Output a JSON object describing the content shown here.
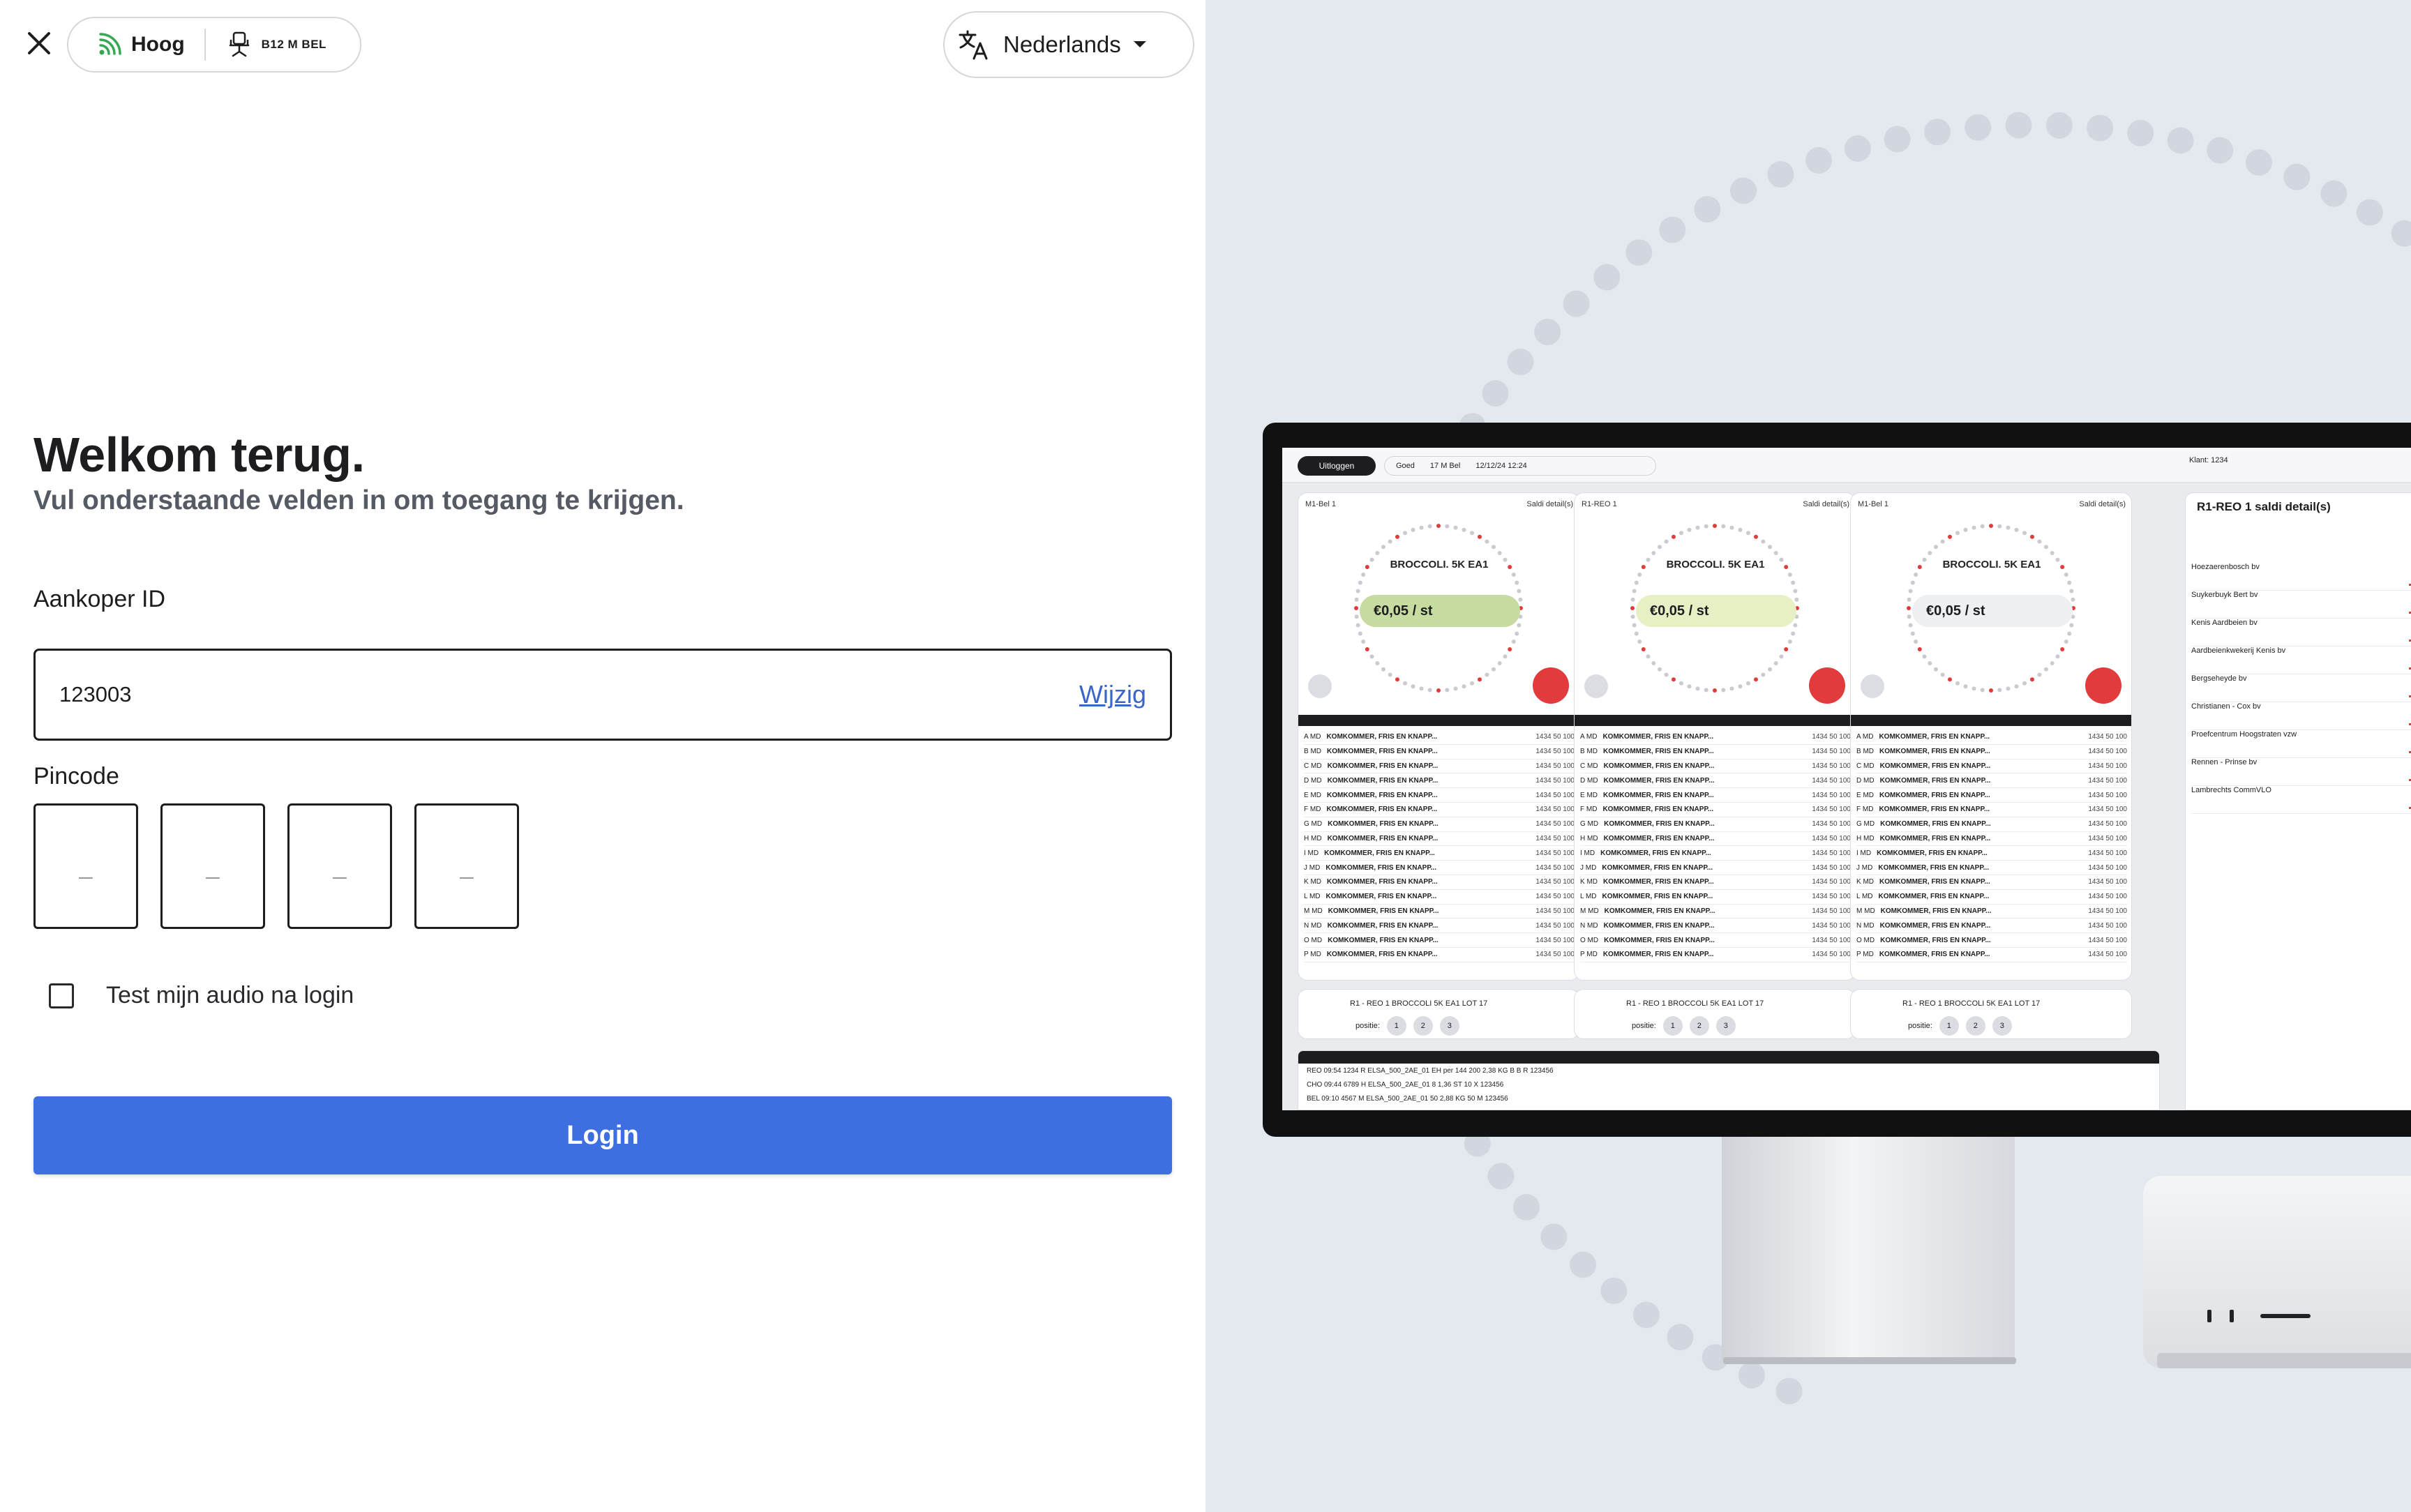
{
  "header": {
    "signal_label": "Hoog",
    "seat_label": "B12 M BEL",
    "language": "Nederlands"
  },
  "login": {
    "title": "Welkom terug.",
    "subtitle": "Vul onderstaande velden in om toegang te krijgen.",
    "buyer_id_label": "Aankoper ID",
    "buyer_id_value": "123003",
    "change_link": "Wijzig",
    "pin_label": "Pincode",
    "pin_placeholder": "_",
    "audio_test_label": "Test mijn audio na login",
    "audio_test_checked": false,
    "login_button": "Login"
  },
  "preview": {
    "logout": "Uitloggen",
    "status_good": "Goed",
    "seat": "17 M Bel",
    "datetime": "12/12/24 12:24",
    "klant": "Klant: 1234",
    "cards": [
      {
        "clock": "M1-Bel 1",
        "saldi": "Saldi detail(s)",
        "product": "BROCCOLI. 5K EA1",
        "price": "€0,05 / st",
        "price_color": "#c7dca0"
      },
      {
        "clock": "R1-REO 1",
        "saldi": "Saldi detail(s)",
        "product": "BROCCOLI. 5K EA1",
        "price": "€0,05 / st",
        "price_color": "#e7f0c4"
      },
      {
        "clock": "M1-Bel 1",
        "saldi": "Saldi detail(s)",
        "product": "BROCCOLI. 5K EA1",
        "price": "€0,05 / st",
        "price_color": "#eef0f2"
      }
    ],
    "row_prefixes": [
      "A MD",
      "B MD",
      "C MD",
      "D MD",
      "E MD",
      "F MD",
      "G MD",
      "H MD",
      "I MD",
      "J MD",
      "K MD",
      "L MD",
      "M MD",
      "N MD",
      "O MD",
      "P MD"
    ],
    "row_product": "KOMKOMMER, FRIS EN KNAPP...",
    "row_values": "1434  50  100",
    "lower_label": "R1 - REO 1  BROCCOLI 5K EA1  LOT 17",
    "position_label": "positie:",
    "positions": [
      "1",
      "2",
      "3"
    ],
    "bottom_rows": [
      "REO   09:54   1234   R   ELSA_500_2AE_01   EH per 144   200   2,38   KG   B   B   R   123456",
      "CHO   09:44   6789   H   ELSA_500_2AE_01   8   1,36   ST   10   X   123456",
      "BEL   09:10   4567   M   ELSA_500_2AE_01   50   2,88   KG   50   M   123456"
    ],
    "side_title": "R1-REO 1 saldi detail(s)",
    "side_rows": [
      "Hoezaerenbosch bv",
      "Suykerbuyk Bert bv",
      "Kenis Aardbeien bv",
      "Aardbeienkwekerij Kenis bv",
      "Bergseheyde bv",
      "Christianen - Cox bv",
      "Proefcentrum Hoogstraten vzw",
      "Rennen - Prinse bv",
      "Lambrechts CommVLO"
    ]
  },
  "colors": {
    "accent": "#3d6fe0",
    "link": "#3a66c8",
    "signal": "#34a853",
    "right_bg": "#e4e8ef"
  }
}
